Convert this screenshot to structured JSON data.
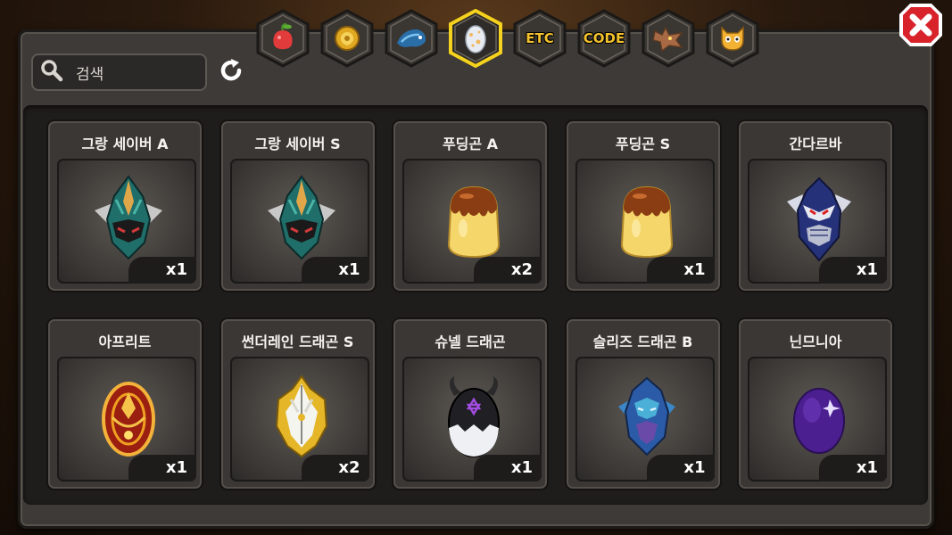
{
  "search": {
    "placeholder": "검색"
  },
  "tabs": [
    {
      "id": "fruit",
      "icon": "fruit-icon",
      "label": ""
    },
    {
      "id": "coin",
      "icon": "gold-coin-icon",
      "label": ""
    },
    {
      "id": "dragon-item",
      "icon": "blue-dragon-icon",
      "label": ""
    },
    {
      "id": "egg",
      "icon": "egg-icon",
      "label": "",
      "selected": true
    },
    {
      "id": "etc",
      "icon": "",
      "label": "ETC"
    },
    {
      "id": "code",
      "icon": "",
      "label": "CODE"
    },
    {
      "id": "dragon-head",
      "icon": "dragon-head-icon",
      "label": ""
    },
    {
      "id": "mascot",
      "icon": "mascot-face-icon",
      "label": ""
    }
  ],
  "items": [
    {
      "name": "그랑 세이버 A",
      "count": "x1",
      "egg": "saber"
    },
    {
      "name": "그랑 세이버 S",
      "count": "x1",
      "egg": "saber"
    },
    {
      "name": "푸딩곤 A",
      "count": "x2",
      "egg": "pudding"
    },
    {
      "name": "푸딩곤 S",
      "count": "x1",
      "egg": "pudding"
    },
    {
      "name": "간다르바",
      "count": "x1",
      "egg": "gandarva"
    },
    {
      "name": "아프리트",
      "count": "x1",
      "egg": "afrit"
    },
    {
      "name": "썬더레인 드래곤 S",
      "count": "x2",
      "egg": "thunder"
    },
    {
      "name": "슈넬 드래곤",
      "count": "x1",
      "egg": "schnell"
    },
    {
      "name": "슬리즈 드래곤 B",
      "count": "x1",
      "egg": "sleeze"
    },
    {
      "name": "닌므니아",
      "count": "x1",
      "egg": "purple"
    }
  ],
  "colors": {
    "accent_gold": "#f2c12e",
    "close_red": "#d8232a",
    "panel": "#3d3a37"
  }
}
